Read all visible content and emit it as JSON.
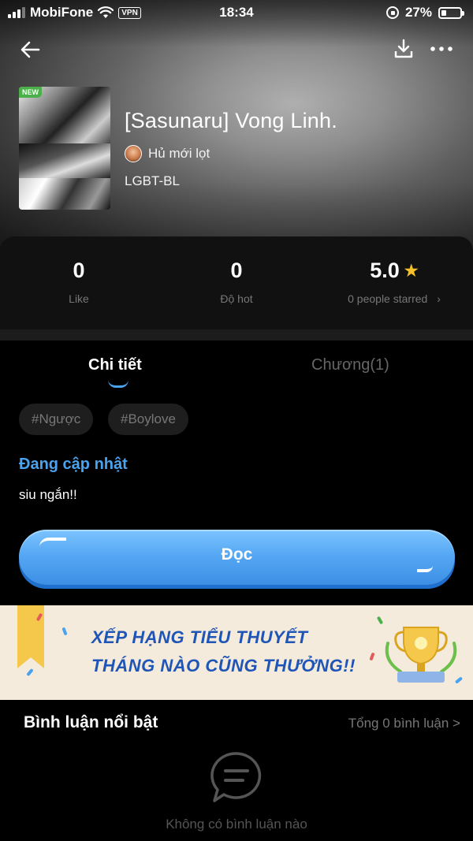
{
  "status_bar": {
    "carrier": "MobiFone",
    "vpn": "VPN",
    "time": "18:34",
    "battery": "27%",
    "battery_level": 0.27
  },
  "nav": {
    "back_icon": "arrow-left-icon",
    "download_icon": "download-icon",
    "more_icon": "more-dots-icon"
  },
  "book": {
    "badge": "NEW",
    "title": "[Sasunaru] Vong Linh.",
    "author": "Hủ mới lọt",
    "category": "LGBT-BL"
  },
  "stats": {
    "like_value": "0",
    "like_label": "Like",
    "hot_value": "0",
    "hot_label": "Độ hot",
    "rating_value": "5.0",
    "rating_label": "0 people starred",
    "rating_chevron": "›"
  },
  "tabs": {
    "detail": "Chi tiết",
    "chapters": "Chương(1)",
    "active": "detail"
  },
  "tags": [
    "#Ngược",
    "#Boylove"
  ],
  "update_status": "Đang cập nhật",
  "description": "siu ngắn!!",
  "read_button": "Đọc",
  "banner": {
    "line1": "XẾP HẠNG TIỂU THUYẾT",
    "line2": "THÁNG NÀO CŨNG THƯỞNG!!"
  },
  "comments": {
    "title": "Bình luận nổi bật",
    "total": "Tổng 0 bình luận >",
    "empty_text": "Không có bình luận nào"
  },
  "colors": {
    "accent_blue": "#4aa3ee",
    "button_blue": "#56a8f4",
    "star": "#f6c02b",
    "banner_text": "#1f55b6",
    "banner_bg": "#f4ebdc"
  }
}
